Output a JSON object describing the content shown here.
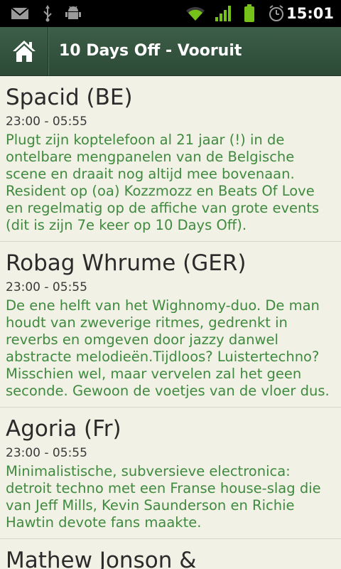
{
  "status_bar": {
    "time": "15:01",
    "icons": [
      "gmail-icon",
      "usb-icon",
      "android-debug-icon",
      "wifi-icon",
      "signal-icon",
      "battery-icon",
      "alarm-icon"
    ]
  },
  "action_bar": {
    "title": "10 Days Off - Vooruit",
    "home_icon": "home-icon"
  },
  "items": [
    {
      "title": "Spacid (BE)",
      "time": "23:00 - 05:55",
      "description": "Plugt zijn koptelefoon al 21 jaar (!) in de ontelbare mengpanelen van de Belgische scene en draait nog altijd mee bovenaan. Resident op (oa) Kozzmozz en Beats Of Love en regelmatig op de affiche van grote events (dit is zijn 7e keer op 10 Days Off)."
    },
    {
      "title": "Robag Whrume (GER)",
      "time": "23:00 - 05:55",
      "description": "De ene helft van het Wighnomy-duo. De man houdt van zweverige ritmes, gedrenkt in reverbs en omgeven door jazzy danwel abstracte melodieën.Tijdloos? Luistertechno? Misschien wel, maar vervelen zal het geen seconde. Gewoon de voetjes van de vloer dus."
    },
    {
      "title": "Agoria (Fr)",
      "time": "23:00 - 05:55",
      "description": "Minimalistische, subversieve electronica: detroit techno met een Franse house-slag die van Jeff Mills, Kevin Saunderson en Richie Hawtin devote fans maakte."
    },
    {
      "title": "Mathew Jonson &",
      "time": "",
      "description": ""
    }
  ],
  "colors": {
    "background": "#f1f1e5",
    "action_bar": "#34543f",
    "description_text": "#3f8a3f"
  }
}
